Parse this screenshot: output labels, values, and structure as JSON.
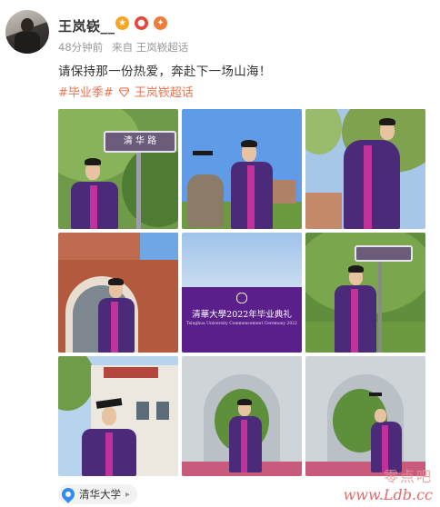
{
  "post": {
    "author": "王岚嵚__",
    "time": "48分钟前",
    "source": "来自 王岚嵚超话",
    "content": "请保持那一份热爱，奔赴下一场山海！",
    "tags": [
      "#毕业季#",
      "王岚嵚超话"
    ],
    "badges": [
      "gold-medal-badge",
      "red-badge",
      "orange-badge"
    ],
    "location": "清华大学",
    "images": [
      {
        "id": 1,
        "sign_text": "清 华 路"
      },
      {
        "id": 2
      },
      {
        "id": 3
      },
      {
        "id": 4
      },
      {
        "id": 5,
        "banner_title": "清華大學2022年毕业典礼",
        "banner_sub": "Tsinghua University Commencement Ceremony 2022"
      },
      {
        "id": 6
      },
      {
        "id": 7
      },
      {
        "id": 8
      },
      {
        "id": 9
      }
    ]
  },
  "watermark": {
    "text_cn": "零点吧",
    "url": "www.Ldb.cc"
  },
  "colors": {
    "tag_accent": "#eb7350",
    "gown_purple": "#4b2a7a",
    "gown_stripe": "#c0329a",
    "location_icon": "#2f8cf5"
  }
}
